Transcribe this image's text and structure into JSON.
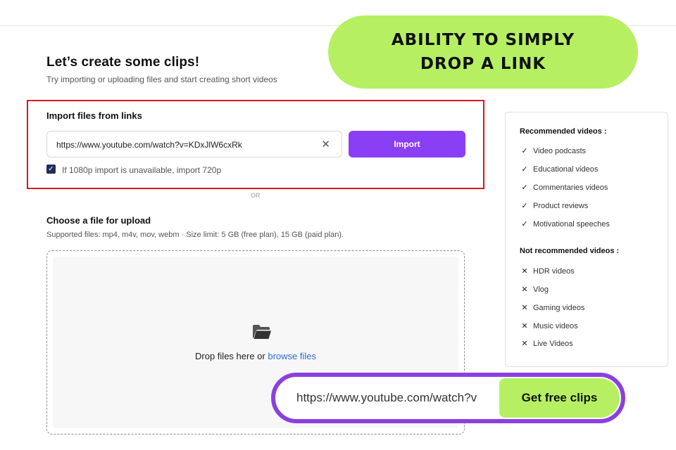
{
  "header": {
    "title": "Let’s create some clips!",
    "subtitle": "Try importing or uploading files and start creating short videos"
  },
  "callout_top": {
    "line1": "ABILITY TO SIMPLY",
    "line2": "DROP A LINK",
    "color": "#b6f062"
  },
  "import": {
    "heading": "Import files from links",
    "url_value": "https://www.youtube.com/watch?v=KDxJlW6cxRk",
    "clear_icon": "✕",
    "button_label": "Import",
    "checkbox_label": "If 1080p import is unavailable, import 720p",
    "checkbox_checked": true,
    "accent": "#8b3ff4",
    "highlight": "#e0111b"
  },
  "divider": {
    "label": "OR"
  },
  "upload": {
    "heading": "Choose a file for upload",
    "info": "Supported files: mp4, m4v, mov, webm  ·  Size limit: 5 GB (free plan), 15 GB (paid plan).",
    "icon": "folder-open-icon",
    "drop_text": "Drop files here or ",
    "browse_label": "browse files"
  },
  "recommended": {
    "title": "Recommended videos :",
    "items": [
      "Video podcasts",
      "Educational videos",
      "Commentaries videos",
      "Product reviews",
      "Motivational speeches"
    ]
  },
  "not_recommended": {
    "title": "Not recommended videos :",
    "items": [
      "HDR videos",
      "Vlog",
      "Gaming videos",
      "Music videos",
      "Live Videos"
    ]
  },
  "callout_bottom": {
    "url_text": "https://www.youtube.com/watch?v",
    "button_label": "Get free clips",
    "border_color": "#8c3fe0"
  }
}
